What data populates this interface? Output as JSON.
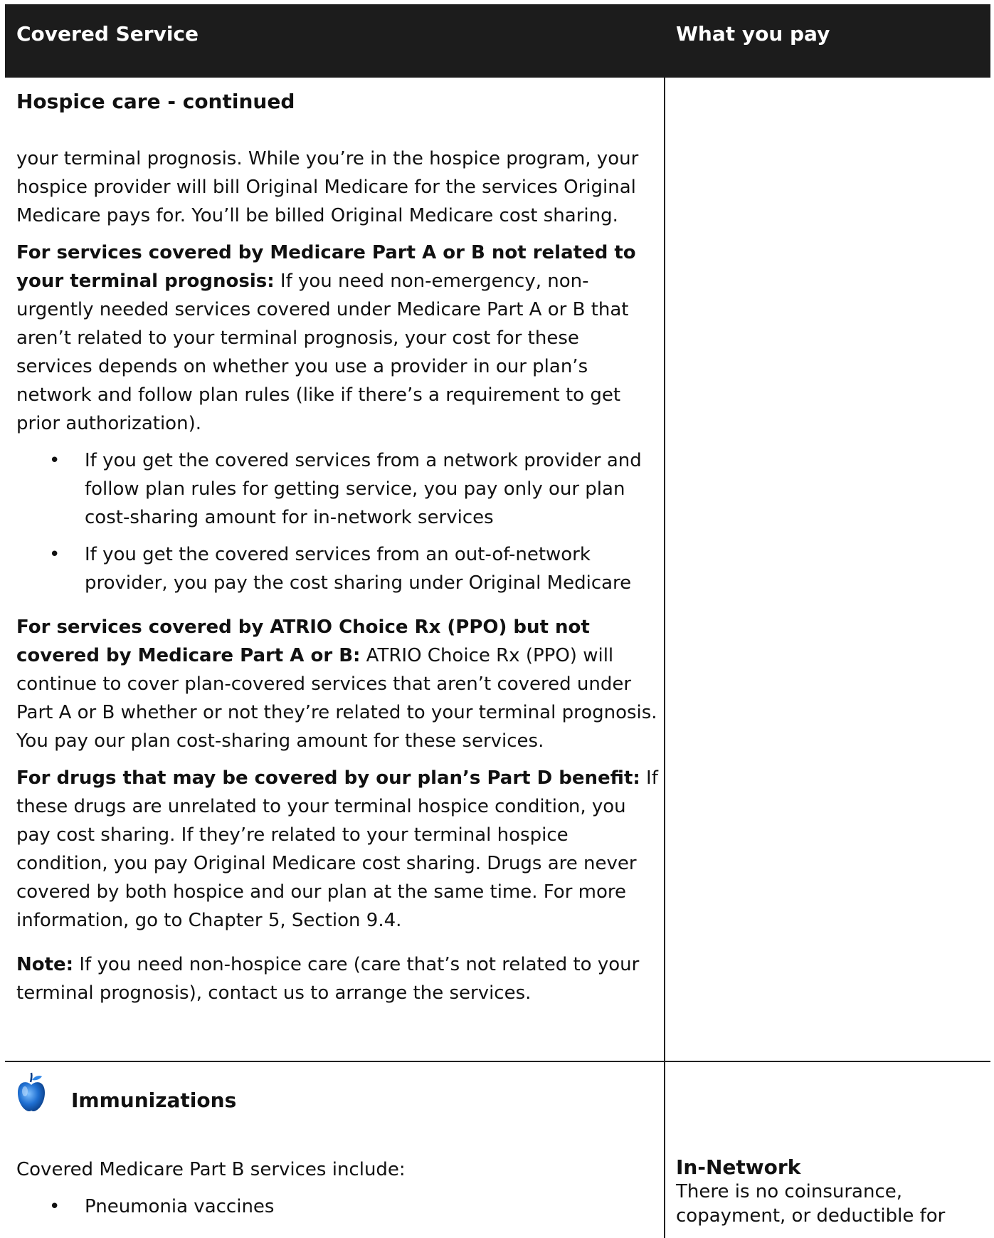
{
  "header": {
    "covered_service": "Covered Service",
    "what_you_pay": "What you pay"
  },
  "hospice": {
    "title": "Hospice care - continued",
    "intro": "your terminal prognosis. While you’re in the hospice program, your hospice provider will bill Original Medicare for the services Original Medicare pays for. You’ll be billed Original Medicare cost sharing.",
    "partab_bold": "For services covered by Medicare Part A or B not related to your terminal prognosis:",
    "partab_text": " If you need non-emergency, non-urgently needed services covered under Medicare Part A or B that aren’t related to your terminal prognosis, your cost for these services depends on whether you use a provider in our plan’s network and follow plan rules (like if there’s a requirement to get prior authorization).",
    "bullets": [
      "If you get the covered services from a network provider and follow plan rules for getting service, you pay only our plan cost-sharing amount for in-network services",
      "If you get the covered services from an out-of-network provider, you pay the cost sharing under Original Medicare"
    ],
    "atrio_bold": "For services covered by ATRIO Choice Rx (PPO) but not covered by Medicare Part A or B:",
    "atrio_text": " ATRIO Choice Rx (PPO) will continue to cover plan-covered services that aren’t covered under Part A or B whether or not they’re related to your terminal prognosis. You pay our plan cost-sharing amount for these services.",
    "drugs_bold": "For drugs that may be covered by our plan’s Part D benefit:",
    "drugs_text": " If these drugs are unrelated to your terminal hospice condition, you pay cost sharing. If they’re related to your terminal hospice condition, you pay Original Medicare cost sharing. Drugs are never covered by both hospice and our plan at the same time. For more information, go to Chapter 5, Section 9.4.",
    "note_bold": "Note:",
    "note_text": " If you need non-hospice care (care that’s not related to your terminal prognosis), contact us to arrange the services."
  },
  "immunizations": {
    "icon": "apple-icon",
    "title": "Immunizations",
    "intro": "Covered Medicare Part B services include:",
    "bullets": [
      "Pneumonia vaccines"
    ],
    "bullet_glyph": "•",
    "pay_heading": "In-Network",
    "pay_text": "There is no coinsurance, copayment, or deductible for"
  },
  "colors": {
    "header_bg": "#1c1c1c",
    "apple_blue": "#1f6fd1"
  }
}
